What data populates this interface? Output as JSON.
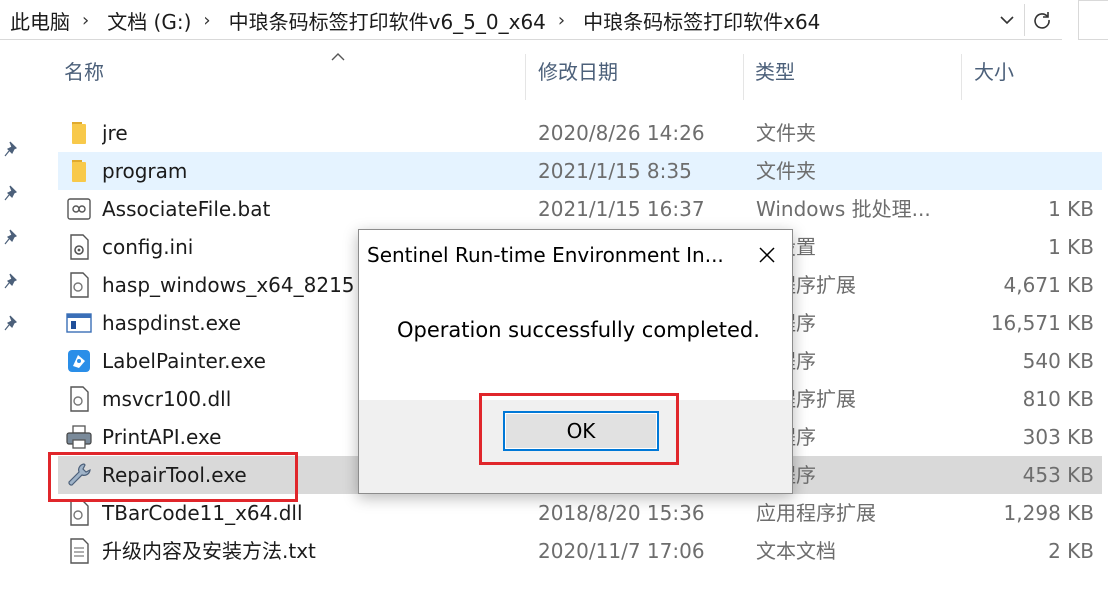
{
  "address": {
    "crumbs": [
      "此电脑",
      "文档 (G:)",
      "中琅条码标签打印软件v6_5_0_x64",
      "中琅条码标签打印软件x64"
    ],
    "separator": "›"
  },
  "columns": {
    "name": "名称",
    "date": "修改日期",
    "type": "类型",
    "size": "大小"
  },
  "files": [
    {
      "name": "jre",
      "date": "2020/8/26 14:26",
      "type": "文件夹",
      "size": "",
      "icon": "folder-icon"
    },
    {
      "name": "program",
      "date": "2021/1/15 8:35",
      "type": "文件夹",
      "size": "",
      "icon": "folder-icon"
    },
    {
      "name": "AssociateFile.bat",
      "date": "2021/1/15 16:37",
      "type": "Windows 批处理...",
      "size": "1 KB",
      "icon": "batch-file-icon"
    },
    {
      "name": "config.ini",
      "date": "",
      "type": "置设置",
      "size": "1 KB",
      "icon": "config-file-icon"
    },
    {
      "name": "hasp_windows_x64_8215",
      "date": "",
      "type": "用程序扩展",
      "size": "4,671 KB",
      "icon": "dll-file-icon"
    },
    {
      "name": "haspdinst.exe",
      "date": "",
      "type": "用程序",
      "size": "16,571 KB",
      "icon": "exe-app-icon"
    },
    {
      "name": "LabelPainter.exe",
      "date": "",
      "type": "用程序",
      "size": "540 KB",
      "icon": "label-painter-icon"
    },
    {
      "name": "msvcr100.dll",
      "date": "",
      "type": "用程序扩展",
      "size": "810 KB",
      "icon": "dll-file-icon"
    },
    {
      "name": "PrintAPI.exe",
      "date": "",
      "type": "用程序",
      "size": "303 KB",
      "icon": "printer-icon"
    },
    {
      "name": "RepairTool.exe",
      "date": "",
      "type": "用程序",
      "size": "453 KB",
      "icon": "wrench-icon"
    },
    {
      "name": "TBarCode11_x64.dll",
      "date": "2018/8/20 15:36",
      "type": "应用程序扩展",
      "size": "1,298 KB",
      "icon": "dll-file-icon"
    },
    {
      "name": "升级内容及安装方法.txt",
      "date": "2020/11/7 17:06",
      "type": "文本文档",
      "size": "2 KB",
      "icon": "text-file-icon"
    }
  ],
  "dialog": {
    "title": "Sentinel Run-time Environment In...",
    "message": "Operation successfully completed.",
    "ok_label": "OK"
  },
  "colors": {
    "hover_row": "#e5f3ff",
    "selected_row": "#d9d9d9",
    "highlight": "#e0262b",
    "focus": "#0078d7",
    "folder": "#f8c94a"
  }
}
